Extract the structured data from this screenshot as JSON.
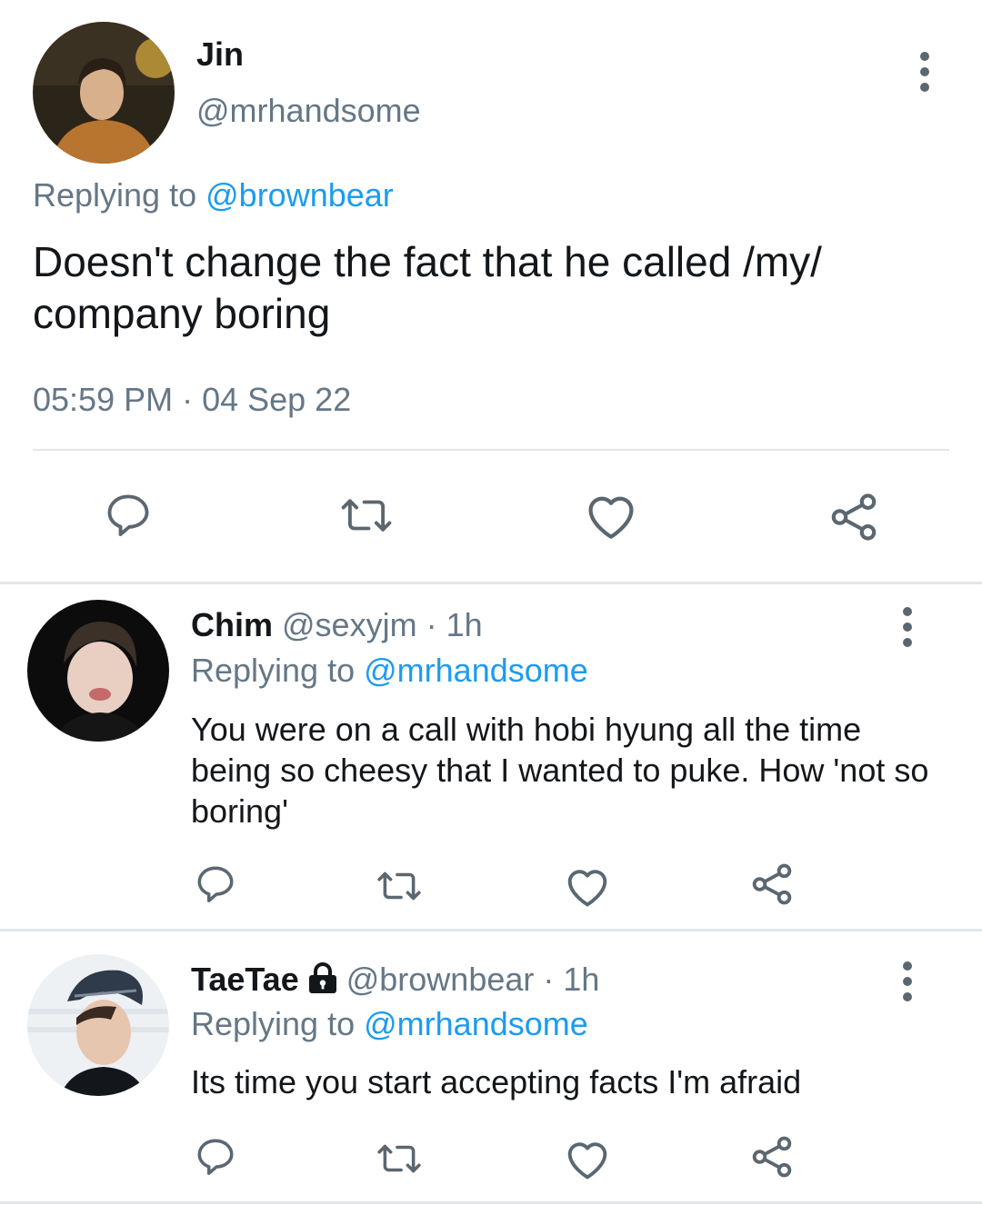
{
  "main_tweet": {
    "name": "Jin",
    "handle": "@mrhandsome",
    "replying_prefix": "Replying to",
    "replying_to": "@brownbear",
    "text": "Doesn't change the fact that he called /my/ company boring",
    "timestamp": "05:59 PM · 04 Sep 22",
    "actions": [
      "reply-icon",
      "retweet-icon",
      "like-icon",
      "share-icon"
    ]
  },
  "replies": [
    {
      "name": "Chim",
      "handle": "@sexyjm",
      "time": "· 1h",
      "replying_prefix": "Replying to",
      "replying_to": "@mrhandsome",
      "text": "You were on a call with hobi hyung all the time being so cheesy that I wanted to puke. How 'not so boring'",
      "locked": false
    },
    {
      "name": "TaeTae",
      "handle": "@brownbear",
      "time": "· 1h",
      "replying_prefix": "Replying to",
      "replying_to": "@mrhandsome",
      "text": "Its time you start accepting facts I'm afraid",
      "locked": true
    }
  ],
  "colors": {
    "link": "#1d9bf0",
    "muted": "#657786",
    "icon": "#5b6770",
    "text": "#14171a"
  }
}
